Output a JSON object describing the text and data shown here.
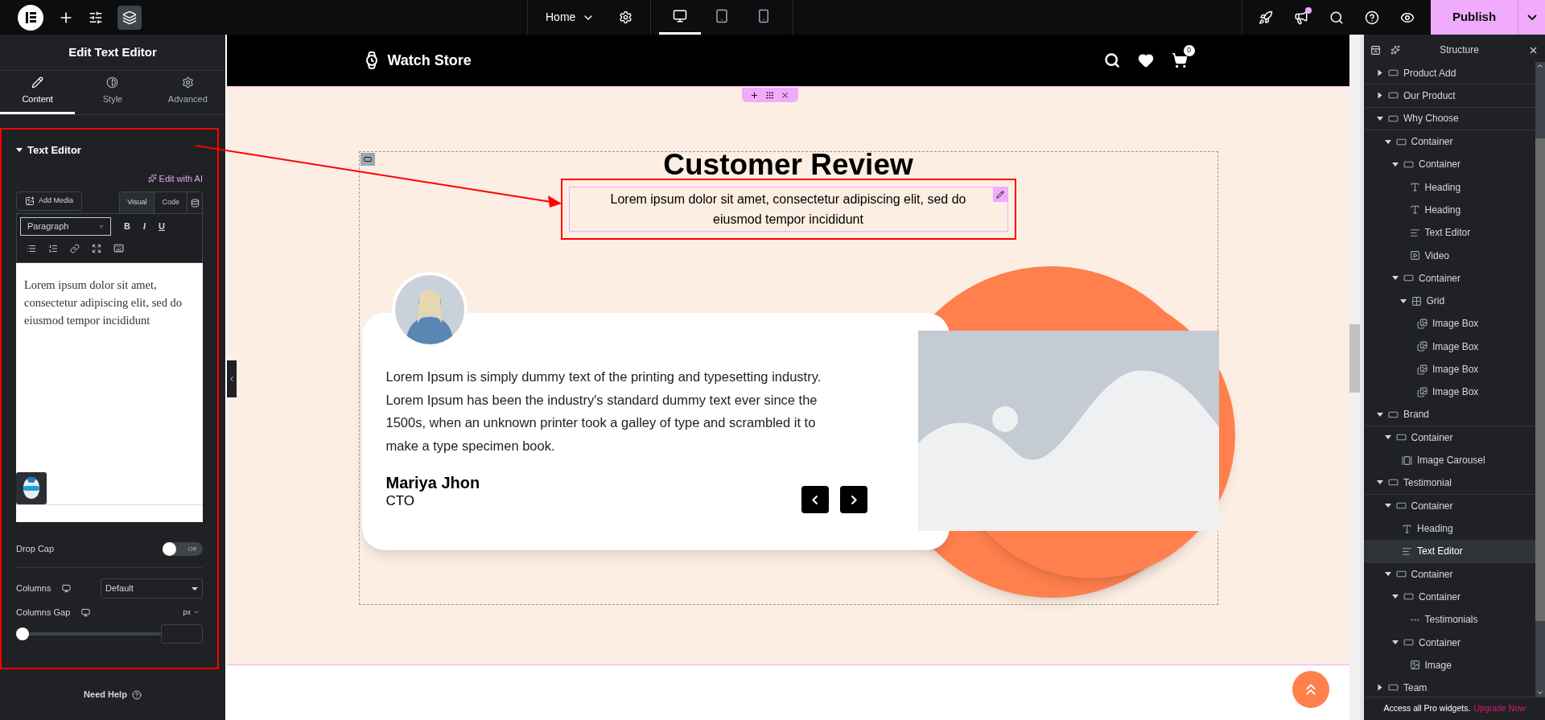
{
  "topbar": {
    "page": "Home",
    "devices": [
      {
        "kind": "desktop",
        "selected": true
      },
      {
        "kind": "tablet",
        "selected": false
      },
      {
        "kind": "mobile",
        "selected": false
      }
    ],
    "notification": true,
    "publish": "Publish"
  },
  "panel": {
    "title": "Edit Text Editor",
    "tabs": [
      {
        "label": "Content",
        "kind": "content",
        "selected": true
      },
      {
        "label": "Style",
        "kind": "style",
        "selected": false
      },
      {
        "label": "Advanced",
        "kind": "advanced",
        "selected": false
      }
    ],
    "section": {
      "title": "Text Editor",
      "expanded": true
    },
    "edit_ai": "Edit with AI",
    "add_media": "Add Media",
    "editor_tabs": [
      {
        "label": "Visual",
        "selected": true
      },
      {
        "label": "Code",
        "selected": false
      }
    ],
    "format": "Paragraph",
    "format_buttons": [
      "B",
      "I",
      "U"
    ],
    "content": "Lorem ipsum dolor sit amet, consectetur adipiscing elit, sed do eiusmod tempor incididunt",
    "drop_cap": {
      "label": "Drop Cap",
      "on": false,
      "state": "Off"
    },
    "columns": {
      "label": "Columns",
      "value": "Default"
    },
    "columns_gap": {
      "label": "Columns Gap",
      "unit": "px",
      "level": 0
    },
    "help": "Need Help"
  },
  "site": {
    "brand": "Watch Store",
    "cart_count": "0",
    "heading": "Customer Review",
    "text": "Lorem ipsum dolor sit amet, consectetur adipiscing elit, sed do eiusmod tempor incididunt",
    "testimonial": {
      "quote": "Lorem Ipsum is simply dummy text of the printing and typesetting industry. Lorem Ipsum has been the industry's standard dummy text ever since the 1500s, when an unknown printer took a galley of type and scrambled it to make a type specimen book.",
      "name": "Mariya Jhon",
      "role": "CTO"
    }
  },
  "structure": {
    "title": "Structure",
    "items": [
      {
        "label": "Product Add",
        "kind": "container",
        "expanded": false,
        "selected": false
      },
      {
        "label": "Our Product",
        "kind": "container",
        "expanded": false,
        "selected": false
      },
      {
        "label": "Why Choose",
        "kind": "container",
        "expanded": true,
        "selected": false,
        "children": [
          {
            "label": "Container",
            "kind": "container",
            "expanded": true,
            "selected": false,
            "children": [
              {
                "label": "Container",
                "kind": "container",
                "expanded": true,
                "selected": false,
                "children": [
                  {
                    "label": "Heading",
                    "kind": "heading",
                    "selected": false
                  },
                  {
                    "label": "Heading",
                    "kind": "heading",
                    "selected": false
                  },
                  {
                    "label": "Text Editor",
                    "kind": "text",
                    "selected": false
                  },
                  {
                    "label": "Video",
                    "kind": "video",
                    "selected": false
                  }
                ]
              },
              {
                "label": "Container",
                "kind": "container",
                "expanded": true,
                "selected": false,
                "children": [
                  {
                    "label": "Grid",
                    "kind": "grid",
                    "expanded": true,
                    "selected": false,
                    "children": [
                      {
                        "label": "Image Box",
                        "kind": "imagebox",
                        "selected": false
                      },
                      {
                        "label": "Image Box",
                        "kind": "imagebox",
                        "selected": false
                      },
                      {
                        "label": "Image Box",
                        "kind": "imagebox",
                        "selected": false
                      },
                      {
                        "label": "Image Box",
                        "kind": "imagebox",
                        "selected": false
                      }
                    ]
                  }
                ]
              }
            ]
          }
        ]
      },
      {
        "label": "Brand",
        "kind": "container",
        "expanded": true,
        "selected": false,
        "children": [
          {
            "label": "Container",
            "kind": "container",
            "expanded": true,
            "selected": false,
            "children": [
              {
                "label": "Image Carousel",
                "kind": "carousel",
                "selected": false
              }
            ]
          }
        ]
      },
      {
        "label": "Testimonial",
        "kind": "container",
        "expanded": true,
        "selected": false,
        "children": [
          {
            "label": "Container",
            "kind": "container",
            "expanded": true,
            "selected": false,
            "children": [
              {
                "label": "Heading",
                "kind": "heading",
                "selected": false
              },
              {
                "label": "Text Editor",
                "kind": "text",
                "selected": true
              }
            ]
          },
          {
            "label": "Container",
            "kind": "container",
            "expanded": true,
            "selected": false,
            "children": [
              {
                "label": "Container",
                "kind": "container",
                "expanded": true,
                "selected": false,
                "children": [
                  {
                    "label": "Testimonials",
                    "kind": "testimonials",
                    "selected": false
                  }
                ]
              },
              {
                "label": "Container",
                "kind": "container",
                "expanded": true,
                "selected": false,
                "children": [
                  {
                    "label": "Image",
                    "kind": "image",
                    "selected": false
                  }
                ]
              }
            ]
          }
        ]
      },
      {
        "label": "Team",
        "kind": "container",
        "expanded": false,
        "selected": false
      }
    ],
    "footer": "Access all Pro widgets.",
    "upgrade": "Upgrade Now"
  }
}
